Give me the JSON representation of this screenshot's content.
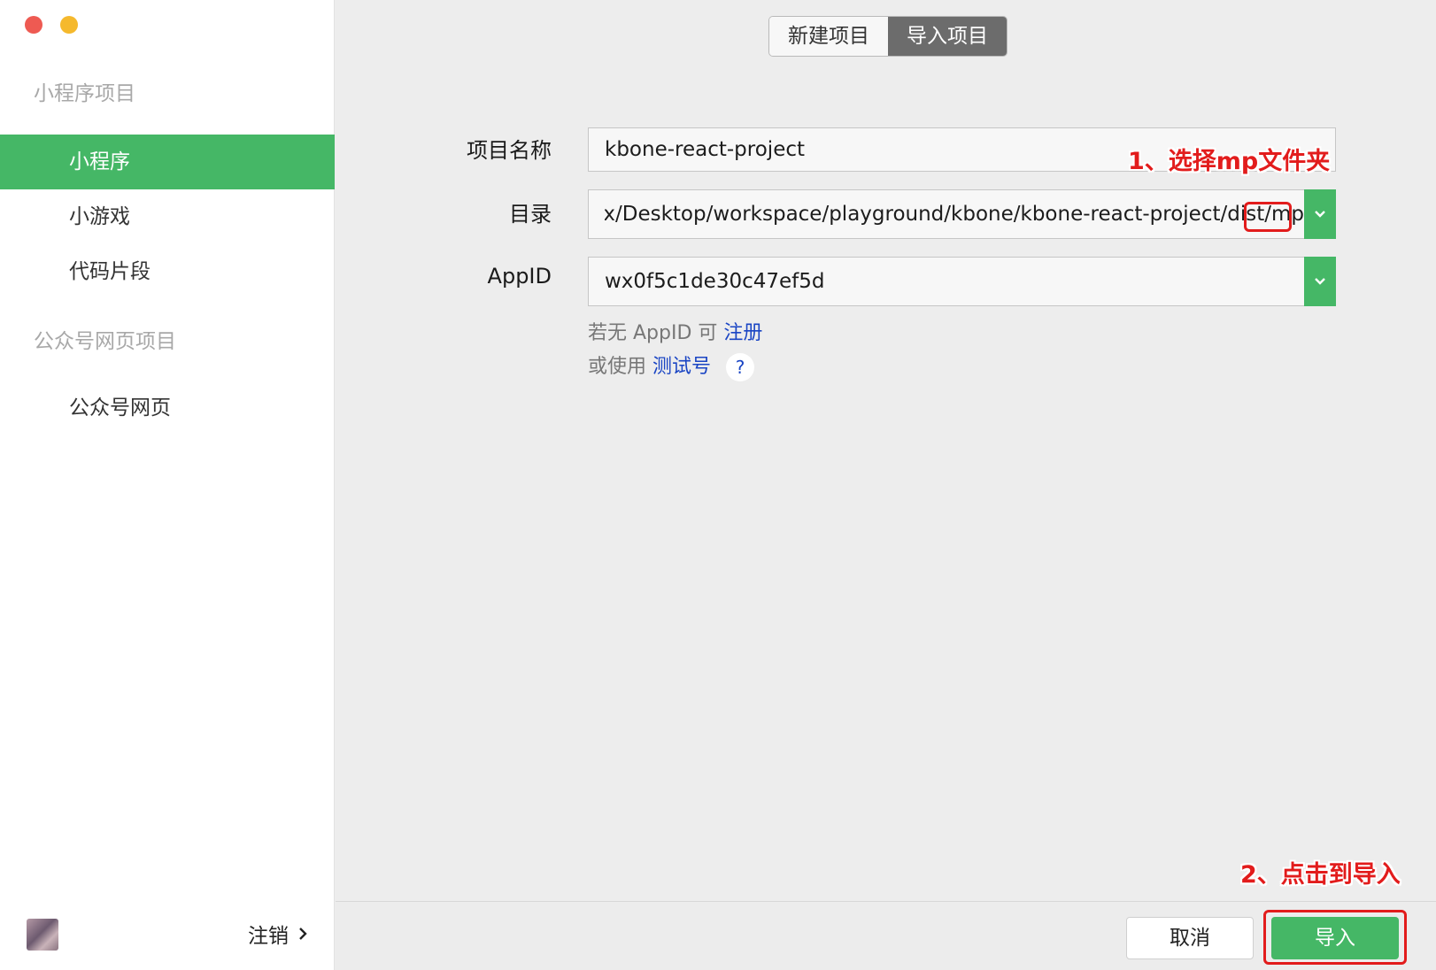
{
  "sidebar": {
    "section_mini": "小程序项目",
    "items": [
      {
        "label": "小程序"
      },
      {
        "label": "小游戏"
      },
      {
        "label": "代码片段"
      }
    ],
    "section_web": "公众号网页项目",
    "web_items": [
      {
        "label": "公众号网页"
      }
    ],
    "logout_label": "注销"
  },
  "tabs": [
    {
      "label": "新建项目"
    },
    {
      "label": "导入项目"
    }
  ],
  "form": {
    "name_label": "项目名称",
    "name_value": "kbone-react-project",
    "dir_label": "目录",
    "dir_value": "elix/Desktop/workspace/playground/kbone/kbone-react-project/dist/mp",
    "appid_label": "AppID",
    "appid_value": "wx0f5c1de30c47ef5d",
    "hint1_prefix": "若无 AppID 可",
    "hint1_link": "注册",
    "hint2_prefix": "或使用",
    "hint2_link": "测试号",
    "help_symbol": "?"
  },
  "annotations": {
    "step1": "1、选择mp文件夹",
    "step2": "2、点击到导入"
  },
  "actions": {
    "cancel_label": "取消",
    "import_label": "导入"
  },
  "colors": {
    "accent_green": "#45b766",
    "annotation_red": "#e21c1c",
    "link_blue": "#1a45c4"
  }
}
